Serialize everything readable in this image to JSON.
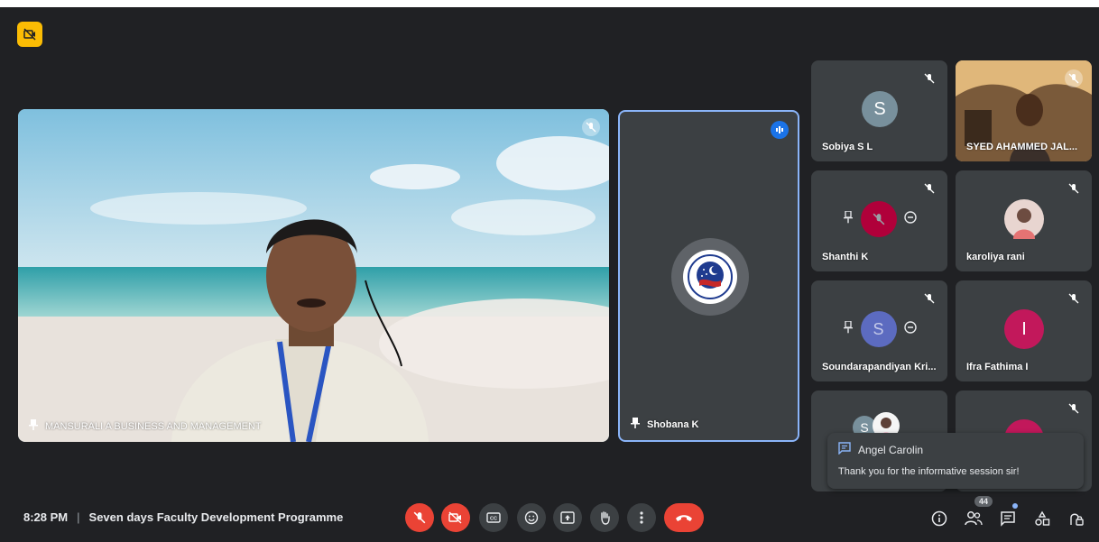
{
  "main_speaker": {
    "name": "MANSURALI A BUSINESS AND MANAGEMENT"
  },
  "pinned_tile": {
    "name": "Shobana K"
  },
  "participants": [
    {
      "name": "Sobiya S L",
      "initial": "S",
      "avatar_color": "#78909c"
    },
    {
      "name": "SYED AHAMMED JAL...",
      "initial": "",
      "avatar_color": "#6d4c41"
    },
    {
      "name": "Shanthi K",
      "initial": "",
      "avatar_color": "#b0003a"
    },
    {
      "name": "karoliya rani",
      "initial": "",
      "avatar_color": "#c2185b"
    },
    {
      "name": "Soundarapandiyan Kri...",
      "initial": "S",
      "avatar_color": "#5c6bc0"
    },
    {
      "name": "Ifra Fathima I",
      "initial": "I",
      "avatar_color": "#c2185b"
    },
    {
      "name": "",
      "initial": "S",
      "avatar_color": "#78909c"
    },
    {
      "name": "",
      "initial": "",
      "avatar_color": "#c2185b"
    }
  ],
  "chat_toast": {
    "sender": "Angel Carolin",
    "message": "Thank you for the informative session sir!"
  },
  "bottom_bar": {
    "time": "8:28 PM",
    "separator": "|",
    "meeting_title": "Seven days Faculty Development Programme",
    "people_count": "44"
  },
  "colors": {
    "accent": "#8ab4f8",
    "danger": "#ea4335",
    "bg": "#202124",
    "tile": "#3c4043",
    "badge": "#fbbc04"
  }
}
